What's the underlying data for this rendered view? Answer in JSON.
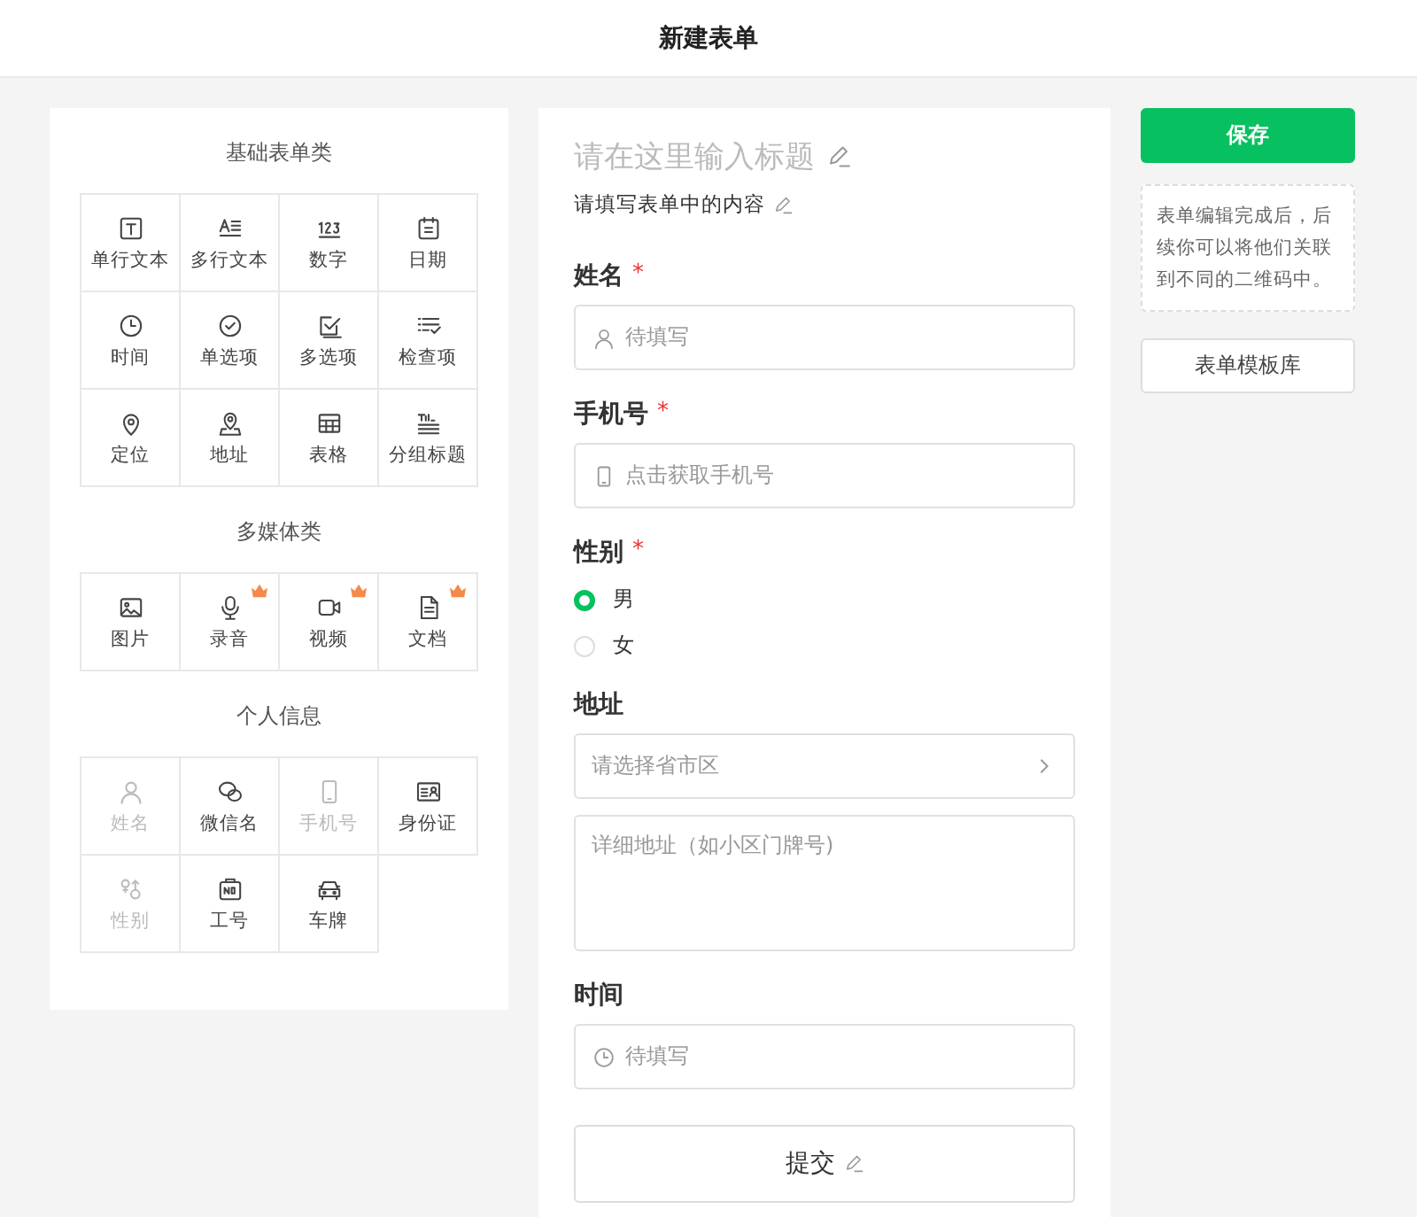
{
  "header": {
    "title": "新建表单"
  },
  "palette": [
    {
      "title": "基础表单类",
      "items": [
        {
          "kind": "text",
          "label": "单行文本",
          "disabled": false,
          "premium": false
        },
        {
          "kind": "multiline",
          "label": "多行文本",
          "disabled": false,
          "premium": false
        },
        {
          "kind": "number",
          "label": "数字",
          "disabled": false,
          "premium": false
        },
        {
          "kind": "date",
          "label": "日期",
          "disabled": false,
          "premium": false
        },
        {
          "kind": "clock",
          "label": "时间",
          "disabled": false,
          "premium": false
        },
        {
          "kind": "radio",
          "label": "单选项",
          "disabled": false,
          "premium": false
        },
        {
          "kind": "checkbox",
          "label": "多选项",
          "disabled": false,
          "premium": false
        },
        {
          "kind": "checklist",
          "label": "检查项",
          "disabled": false,
          "premium": false
        },
        {
          "kind": "pin",
          "label": "定位",
          "disabled": false,
          "premium": false
        },
        {
          "kind": "address",
          "label": "地址",
          "disabled": false,
          "premium": false
        },
        {
          "kind": "table",
          "label": "表格",
          "disabled": false,
          "premium": false
        },
        {
          "kind": "heading",
          "label": "分组标题",
          "disabled": false,
          "premium": false
        }
      ]
    },
    {
      "title": "多媒体类",
      "items": [
        {
          "kind": "image",
          "label": "图片",
          "disabled": false,
          "premium": false
        },
        {
          "kind": "mic",
          "label": "录音",
          "disabled": false,
          "premium": true
        },
        {
          "kind": "video",
          "label": "视频",
          "disabled": false,
          "premium": true
        },
        {
          "kind": "doc",
          "label": "文档",
          "disabled": false,
          "premium": true
        }
      ]
    },
    {
      "title": "个人信息",
      "items": [
        {
          "kind": "person",
          "label": "姓名",
          "disabled": true,
          "premium": false
        },
        {
          "kind": "chat",
          "label": "微信名",
          "disabled": false,
          "premium": false
        },
        {
          "kind": "phone",
          "label": "手机号",
          "disabled": true,
          "premium": false
        },
        {
          "kind": "idcard",
          "label": "身份证",
          "disabled": false,
          "premium": false
        },
        {
          "kind": "gender",
          "label": "性别",
          "disabled": true,
          "premium": false
        },
        {
          "kind": "badge",
          "label": "工号",
          "disabled": false,
          "premium": false
        },
        {
          "kind": "car",
          "label": "车牌",
          "disabled": false,
          "premium": false
        }
      ]
    }
  ],
  "form": {
    "title_placeholder": "请在这里输入标题",
    "description": "请填写表单中的内容",
    "fields": [
      {
        "kind": "name",
        "label": "姓名",
        "required_mark": "*",
        "placeholder": "待填写"
      },
      {
        "kind": "phone",
        "label": "手机号",
        "required_mark": "*",
        "placeholder": "点击获取手机号"
      },
      {
        "kind": "radio",
        "label": "性别",
        "required_mark": "*",
        "options": [
          {
            "label": "男",
            "selected": true
          },
          {
            "label": "女",
            "selected": false
          }
        ]
      },
      {
        "kind": "address",
        "label": "地址",
        "placeholder": "请选择省市区",
        "detail_placeholder": "详细地址（如小区门牌号)"
      },
      {
        "kind": "time",
        "label": "时间",
        "placeholder": "待填写"
      }
    ],
    "submit": "提交"
  },
  "sidebar": {
    "save": "保存",
    "hint": "表单编辑完成后，后续你可以将他们关联到不同的二维码中。",
    "templates": "表单模板库"
  }
}
